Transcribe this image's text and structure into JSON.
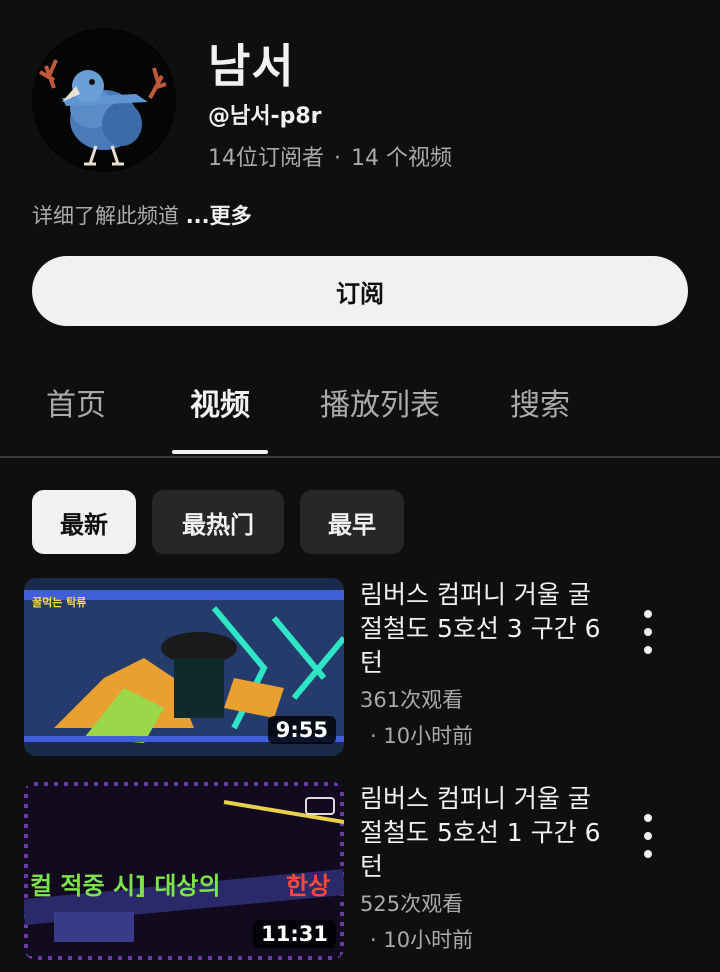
{
  "channel": {
    "name": "남서",
    "handle": "@남서-p8r",
    "subscribers": "14位订阅者",
    "separator": "·",
    "video_count": "14 个视频",
    "about": "详细了解此频道",
    "more": "...更多",
    "subscribe_label": "订阅"
  },
  "tabs": [
    {
      "label": "首页"
    },
    {
      "label": "视频"
    },
    {
      "label": "播放列表"
    },
    {
      "label": "搜索"
    }
  ],
  "active_tab": "视频",
  "chips": [
    {
      "label": "最新"
    },
    {
      "label": "最热门"
    },
    {
      "label": "最早"
    }
  ],
  "active_chip": "最新",
  "videos": [
    {
      "title": "림버스 컴퍼니 거울 굴절철도 5호선 3 구간 6턴",
      "views": "361次观看",
      "time": "· 10小时前",
      "duration": "9:55",
      "thumb_label": "꿀먹는 탁류"
    },
    {
      "title": "림버스 컴퍼니 거울 굴절철도 5호선 1 구간 6턴",
      "views": "525次观看",
      "time": "· 10小时前",
      "duration": "11:31",
      "thumb_text": "컬 적중 시] 대상의",
      "thumb_text_red": "한상"
    }
  ],
  "colors": {
    "background": "#0f0f0f",
    "text_primary": "#f1f1f1",
    "text_secondary": "#aaaaaa",
    "chip_bg": "#272727"
  }
}
